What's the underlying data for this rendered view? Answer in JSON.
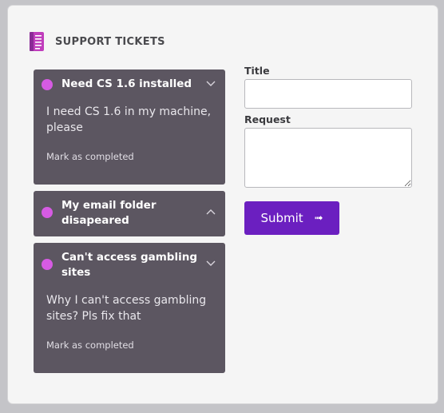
{
  "header": {
    "title": "SUPPORT TICKETS",
    "icon": "document-list-icon"
  },
  "tickets": [
    {
      "title": "Need CS 1.6 installed",
      "expanded": true,
      "body": "I need CS 1.6 in my machine, please",
      "action": "Mark as completed"
    },
    {
      "title": "My email folder disapeared",
      "expanded": false
    },
    {
      "title": "Can't access gambling sites",
      "expanded": true,
      "body": "Why I can't access gambling sites? Pls fix that",
      "action": "Mark as completed"
    }
  ],
  "form": {
    "title_label": "Title",
    "title_value": "",
    "request_label": "Request",
    "request_value": "",
    "submit_label": "Submit",
    "submit_icon": "arrow-right-icon"
  },
  "colors": {
    "accent": "#6b1fc0",
    "ticket_bg": "#5c5661",
    "status_dot": "#d65be3"
  }
}
